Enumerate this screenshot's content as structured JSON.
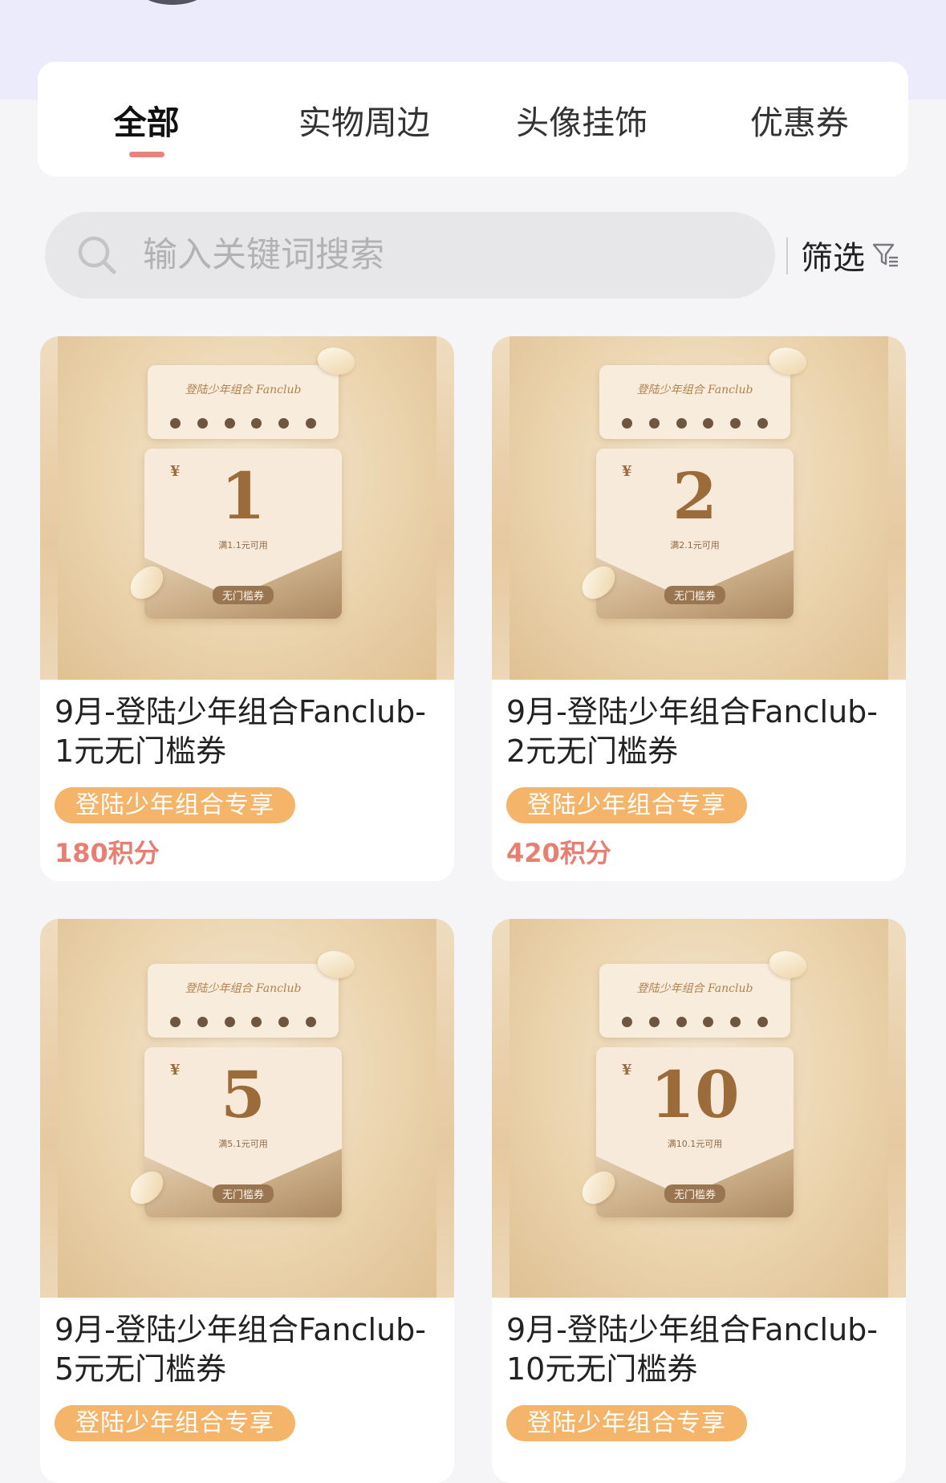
{
  "tabs": [
    {
      "label": "全部",
      "active": true
    },
    {
      "label": "实物周边",
      "active": false
    },
    {
      "label": "头像挂饰",
      "active": false
    },
    {
      "label": "优惠券",
      "active": false
    }
  ],
  "search": {
    "placeholder": "输入关键词搜索",
    "icon": "search-icon"
  },
  "filter": {
    "label": "筛选",
    "icon": "filter-icon"
  },
  "products": [
    {
      "title": "9月-登陆少年组合Fanclub-1元无门槛券",
      "badge": "登陆少年组合专享",
      "price": "180积分",
      "coupon": {
        "brand": "登陆少年组合 Fanclub",
        "currency": "¥",
        "amount": "1",
        "condition": "满1.1元可用",
        "tag": "无门槛券"
      }
    },
    {
      "title": "9月-登陆少年组合Fanclub-2元无门槛券",
      "badge": "登陆少年组合专享",
      "price": "420积分",
      "coupon": {
        "brand": "登陆少年组合 Fanclub",
        "currency": "¥",
        "amount": "2",
        "condition": "满2.1元可用",
        "tag": "无门槛券"
      }
    },
    {
      "title": "9月-登陆少年组合Fanclub-5元无门槛券",
      "badge": "登陆少年组合专享",
      "price": "",
      "coupon": {
        "brand": "登陆少年组合 Fanclub",
        "currency": "¥",
        "amount": "5",
        "condition": "满5.1元可用",
        "tag": "无门槛券"
      }
    },
    {
      "title": "9月-登陆少年组合Fanclub-10元无门槛券",
      "badge": "登陆少年组合专享",
      "price": "",
      "coupon": {
        "brand": "登陆少年组合 Fanclub",
        "currency": "¥",
        "amount": "10",
        "condition": "满10.1元可用",
        "tag": "无门槛券"
      }
    }
  ],
  "colors": {
    "accent": "#e8837c",
    "badge": "#f4b46a",
    "price": "#e77f73",
    "header_band": "#ecebfb"
  }
}
